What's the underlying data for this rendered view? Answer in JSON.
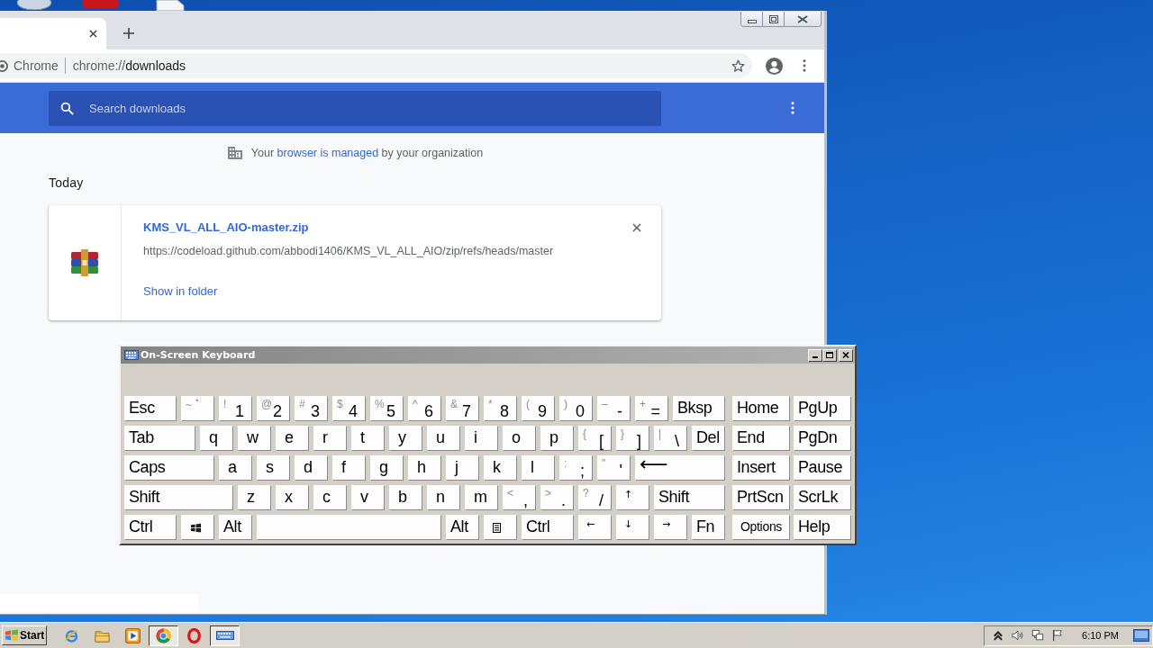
{
  "browser": {
    "omnibox": {
      "site_chip": "Chrome",
      "url_scheme": "chrome://",
      "url_rest": "downloads"
    },
    "search": {
      "placeholder": "Search downloads"
    },
    "managed_notice": {
      "before": "Your",
      "link": "browser is managed",
      "after": "by your organization"
    },
    "section_title": "Today",
    "downloads": [
      {
        "file_name": "KMS_VL_ALL_AIO-master.zip",
        "url": "https://codeload.github.com/abbodi1406/KMS_VL_ALL_AIO/zip/refs/heads/master",
        "action": "Show in folder"
      }
    ]
  },
  "keyboard": {
    "title": "On-Screen Keyboard",
    "rows": [
      {
        "keys": [
          {
            "kind": "label",
            "label": "Esc"
          },
          {
            "kind": "pair",
            "shift": "~",
            "base": "`"
          },
          {
            "kind": "dual",
            "shift": "!",
            "base": "1"
          },
          {
            "kind": "dual",
            "shift": "@",
            "base": "2"
          },
          {
            "kind": "dual",
            "shift": "#",
            "base": "3"
          },
          {
            "kind": "dual",
            "shift": "$",
            "base": "4"
          },
          {
            "kind": "dual",
            "shift": "%",
            "base": "5"
          },
          {
            "kind": "dual",
            "shift": "^",
            "base": "6"
          },
          {
            "kind": "dual",
            "shift": "&",
            "base": "7"
          },
          {
            "kind": "dual",
            "shift": "*",
            "base": "8"
          },
          {
            "kind": "dual",
            "shift": "(",
            "base": "9"
          },
          {
            "kind": "dual",
            "shift": ")",
            "base": "0"
          },
          {
            "kind": "dual",
            "shift": "–",
            "base": "-"
          },
          {
            "kind": "dual",
            "shift": "+",
            "base": "="
          },
          {
            "kind": "label",
            "label": "Bksp"
          }
        ]
      },
      {
        "keys": [
          {
            "kind": "label",
            "label": "Tab"
          },
          {
            "kind": "letter",
            "label": "q"
          },
          {
            "kind": "letter",
            "label": "w"
          },
          {
            "kind": "letter",
            "label": "e"
          },
          {
            "kind": "letter",
            "label": "r"
          },
          {
            "kind": "letter",
            "label": "t"
          },
          {
            "kind": "letter",
            "label": "y"
          },
          {
            "kind": "letter",
            "label": "u"
          },
          {
            "kind": "letter",
            "label": "i"
          },
          {
            "kind": "letter",
            "label": "o"
          },
          {
            "kind": "letter",
            "label": "p"
          },
          {
            "kind": "dual",
            "shift": "{",
            "base": "["
          },
          {
            "kind": "dual",
            "shift": "}",
            "base": "]"
          },
          {
            "kind": "dual",
            "shift": "|",
            "base": "\\"
          },
          {
            "kind": "label",
            "label": "Del"
          }
        ]
      },
      {
        "keys": [
          {
            "kind": "label",
            "label": "Caps"
          },
          {
            "kind": "letter",
            "label": "a"
          },
          {
            "kind": "letter",
            "label": "s"
          },
          {
            "kind": "letter",
            "label": "d"
          },
          {
            "kind": "letter",
            "label": "f"
          },
          {
            "kind": "letter",
            "label": "g"
          },
          {
            "kind": "letter",
            "label": "h"
          },
          {
            "kind": "letter",
            "label": "j"
          },
          {
            "kind": "letter",
            "label": "k"
          },
          {
            "kind": "letter",
            "label": "l"
          },
          {
            "kind": "dual",
            "shift": ":",
            "base": ";"
          },
          {
            "kind": "dual",
            "shift": "\"",
            "base": "'"
          },
          {
            "kind": "enter",
            "label": "⟵"
          }
        ]
      },
      {
        "keys": [
          {
            "kind": "label",
            "label": "Shift"
          },
          {
            "kind": "letter",
            "label": "z"
          },
          {
            "kind": "letter",
            "label": "x"
          },
          {
            "kind": "letter",
            "label": "c"
          },
          {
            "kind": "letter",
            "label": "v"
          },
          {
            "kind": "letter",
            "label": "b"
          },
          {
            "kind": "letter",
            "label": "n"
          },
          {
            "kind": "letter",
            "label": "m"
          },
          {
            "kind": "dual",
            "shift": "<",
            "base": ","
          },
          {
            "kind": "dual",
            "shift": ">",
            "base": "."
          },
          {
            "kind": "dual",
            "shift": "?",
            "base": "/"
          },
          {
            "kind": "arrow",
            "label": "↑"
          },
          {
            "kind": "label",
            "label": "Shift"
          }
        ]
      },
      {
        "keys": [
          {
            "kind": "label",
            "label": "Ctrl"
          },
          {
            "kind": "logo"
          },
          {
            "kind": "label",
            "label": "Alt"
          },
          {
            "kind": "space"
          },
          {
            "kind": "label",
            "label": "Alt"
          },
          {
            "kind": "menu"
          },
          {
            "kind": "label",
            "label": "Ctrl"
          },
          {
            "kind": "arrow",
            "label": "←"
          },
          {
            "kind": "arrow",
            "label": "↓"
          },
          {
            "kind": "arrow",
            "label": "→"
          },
          {
            "kind": "label",
            "label": "Fn"
          }
        ]
      }
    ],
    "side_rows": [
      {
        "keys": [
          {
            "kind": "label",
            "label": "Home"
          },
          {
            "kind": "label",
            "label": "PgUp"
          }
        ]
      },
      {
        "keys": [
          {
            "kind": "label",
            "label": "End"
          },
          {
            "kind": "label",
            "label": "PgDn"
          }
        ]
      },
      {
        "keys": [
          {
            "kind": "label",
            "label": "Insert"
          },
          {
            "kind": "label",
            "label": "Pause"
          }
        ]
      },
      {
        "keys": [
          {
            "kind": "label",
            "label": "PrtScn"
          },
          {
            "kind": "label",
            "label": "ScrLk"
          }
        ]
      },
      {
        "keys": [
          {
            "kind": "small",
            "label": "Options"
          },
          {
            "kind": "label",
            "label": "Help"
          }
        ]
      }
    ]
  },
  "taskbar": {
    "start_label": "Start",
    "apps": [
      {
        "kind": "swoosh",
        "selected": false
      },
      {
        "kind": "folder",
        "selected": false
      },
      {
        "kind": "player",
        "selected": false
      },
      {
        "kind": "wheel",
        "selected": true
      },
      {
        "kind": "ring",
        "selected": false
      },
      {
        "kind": "keyboard",
        "selected": true
      }
    ],
    "clock": "6:10 PM"
  }
}
